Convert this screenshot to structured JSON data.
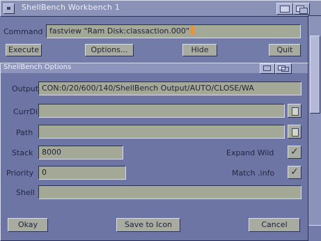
{
  "window": {
    "title": "ShellBench  Workbench 1"
  },
  "command": {
    "label": "Command",
    "value": "fastview \"Ram Disk:classaction.000\""
  },
  "buttons": {
    "execute": "Execute",
    "options": "Options...",
    "hide": "Hide",
    "quit": "Quit"
  },
  "options_window": {
    "title": "ShellBench Options",
    "output_label": "Output",
    "output_value": "CON:0/20/600/140/ShellBench Output/AUTO/CLOSE/WA",
    "currdir_label": "CurrDir",
    "currdir_value": "",
    "path_label": "Path",
    "path_value": "",
    "stack_label": "Stack",
    "stack_value": "8000",
    "priority_label": "Priority",
    "priority_value": "0",
    "shell_label": "Shell",
    "shell_value": "",
    "expand_wild_label": "Expand Wild",
    "expand_wild_checked": true,
    "match_info_label": "Match .info",
    "match_info_checked": true,
    "check_mark": "✓",
    "okay_button": "Okay",
    "save_button": "Save to Icon",
    "cancel_button": "Cancel"
  },
  "colors": {
    "background": "#6f78a6",
    "field": "#a4a897",
    "cursor": "#e8933b"
  }
}
